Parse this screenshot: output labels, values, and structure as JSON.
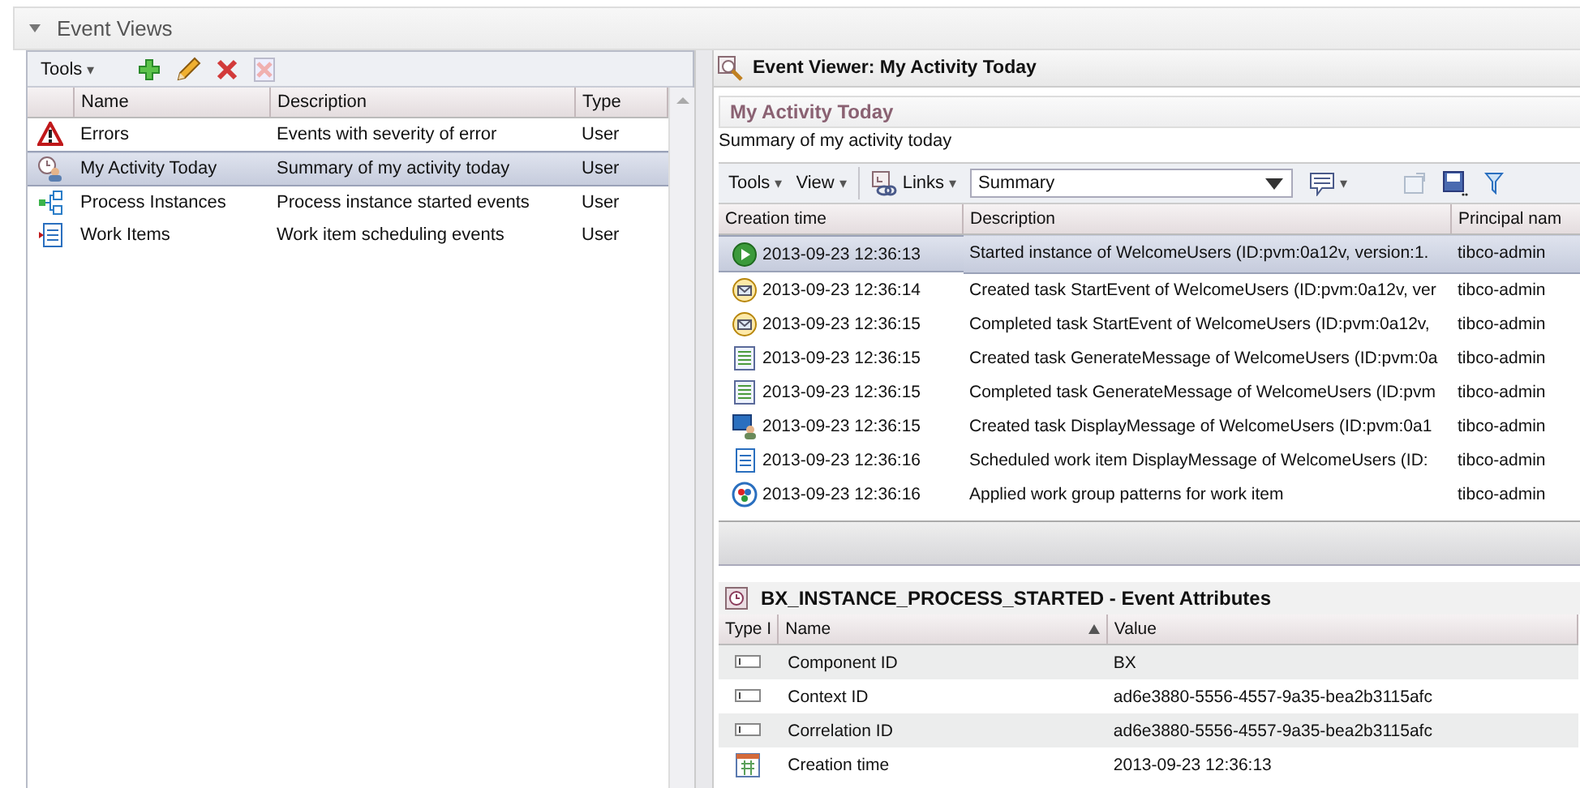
{
  "section": {
    "title": "Event Views",
    "expanded": true
  },
  "views": {
    "toolbar": {
      "tools": "Tools",
      "tools_caret": "▾"
    },
    "columns": [
      "Name",
      "Description",
      "Type"
    ],
    "rows": [
      {
        "kind": "error",
        "name": "Errors",
        "description": "Events with severity of error",
        "type": "User",
        "selected": false
      },
      {
        "kind": "activity",
        "name": "My Activity Today",
        "description": "Summary of my activity today",
        "type": "User",
        "selected": true
      },
      {
        "kind": "process",
        "name": "Process Instances",
        "description": "Process instance started events",
        "type": "User",
        "selected": false
      },
      {
        "kind": "workitem",
        "name": "Work Items",
        "description": "Work item scheduling events",
        "type": "User",
        "selected": false
      }
    ]
  },
  "viewer": {
    "title": "Event Viewer: My Activity Today",
    "subtitle": "My Activity Today",
    "summary": "Summary of my activity today",
    "toolbar": {
      "tools": "Tools",
      "view": "View",
      "links": "Links",
      "caret": "▾",
      "filter_value": "Summary"
    },
    "columns": [
      "Creation time",
      "Description",
      "Principal nam"
    ],
    "rows": [
      {
        "kind": "start",
        "time": "2013-09-23 12:36:13",
        "description": "Started instance of WelcomeUsers (ID:pvm:0a12v, version:1.",
        "principal": "tibco-admin",
        "selected": true
      },
      {
        "kind": "mail",
        "time": "2013-09-23 12:36:14",
        "description": "Created task StartEvent of WelcomeUsers (ID:pvm:0a12v, ver",
        "principal": "tibco-admin",
        "selected": false
      },
      {
        "kind": "mail",
        "time": "2013-09-23 12:36:15",
        "description": "Completed task StartEvent of WelcomeUsers (ID:pvm:0a12v,",
        "principal": "tibco-admin",
        "selected": false
      },
      {
        "kind": "script",
        "time": "2013-09-23 12:36:15",
        "description": "Created task GenerateMessage of WelcomeUsers (ID:pvm:0a",
        "principal": "tibco-admin",
        "selected": false
      },
      {
        "kind": "script",
        "time": "2013-09-23 12:36:15",
        "description": "Completed task GenerateMessage of WelcomeUsers (ID:pvm",
        "principal": "tibco-admin",
        "selected": false
      },
      {
        "kind": "user",
        "time": "2013-09-23 12:36:15",
        "description": "Created task DisplayMessage of WelcomeUsers (ID:pvm:0a1",
        "principal": "tibco-admin",
        "selected": false
      },
      {
        "kind": "list",
        "time": "2013-09-23 12:36:16",
        "description": "Scheduled work item DisplayMessage of WelcomeUsers (ID:",
        "principal": "tibco-admin",
        "selected": false
      },
      {
        "kind": "group",
        "time": "2013-09-23 12:36:16",
        "description": "Applied work group patterns for work item",
        "principal": "tibco-admin",
        "selected": false
      }
    ]
  },
  "attributes": {
    "title": "BX_INSTANCE_PROCESS_STARTED - Event Attributes",
    "columns": [
      "Type I",
      "Name",
      "Value"
    ],
    "rows": [
      {
        "kind": "text",
        "name": "Component ID",
        "value": "BX"
      },
      {
        "kind": "text",
        "name": "Context ID",
        "value": "ad6e3880-5556-4557-9a35-bea2b3115afc"
      },
      {
        "kind": "text",
        "name": "Correlation ID",
        "value": "ad6e3880-5556-4557-9a35-bea2b3115afc"
      },
      {
        "kind": "date",
        "name": "Creation time",
        "value": "2013-09-23 12:36:13"
      }
    ]
  }
}
